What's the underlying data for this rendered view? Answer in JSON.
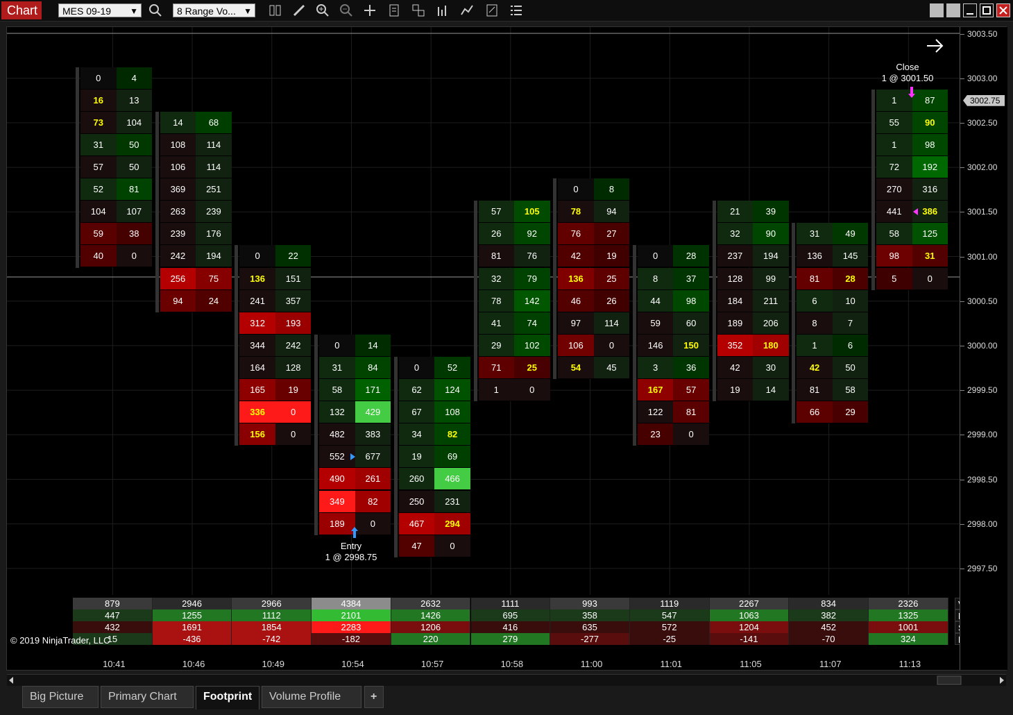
{
  "toolbar": {
    "title": "Chart",
    "instrument": "MES 09-19",
    "bar_type": "8 Range Vo...",
    "icons": [
      "search-icon",
      "bar-type-icon",
      "draw-icon",
      "zoom-in-icon",
      "zoom-out-icon",
      "crosshair-icon",
      "data-box-icon",
      "templates-icon",
      "indicators-icon",
      "strategies-icon",
      "properties-icon",
      "list-icon"
    ]
  },
  "colors": {
    "bid_strong": "#ff1a1a",
    "ask_strong": "#33cc33",
    "background": "#000000",
    "highlight_text": "#ffff00"
  },
  "price_axis": {
    "labels": [
      "3003.50",
      "3003.00",
      "3002.50",
      "3002.00",
      "3001.50",
      "3001.00",
      "3000.50",
      "3000.00",
      "2999.50",
      "2999.00",
      "2998.50",
      "2998.00",
      "2997.50"
    ],
    "current_price": "3002.75"
  },
  "bars": [
    {
      "time": "10:41",
      "top_price": 3003.0,
      "rows": [
        [
          "0",
          "4"
        ],
        [
          "16",
          "13"
        ],
        [
          "73",
          "104"
        ],
        [
          "31",
          "50"
        ],
        [
          "57",
          "50"
        ],
        [
          "52",
          "81"
        ],
        [
          "104",
          "107"
        ],
        [
          "59",
          "38"
        ],
        [
          "40",
          "0"
        ]
      ],
      "hl": [
        [
          1,
          0
        ],
        [
          2,
          0
        ]
      ]
    },
    {
      "time": "10:46",
      "top_price": 3002.5,
      "rows": [
        [
          "14",
          "68"
        ],
        [
          "108",
          "114"
        ],
        [
          "106",
          "114"
        ],
        [
          "369",
          "251"
        ],
        [
          "263",
          "239"
        ],
        [
          "239",
          "176"
        ],
        [
          "242",
          "194"
        ],
        [
          "256",
          "75"
        ],
        [
          "94",
          "24"
        ]
      ],
      "hl": []
    },
    {
      "time": "10:49",
      "top_price": 3001.0,
      "rows": [
        [
          "0",
          "22"
        ],
        [
          "136",
          "151"
        ],
        [
          "241",
          "357"
        ],
        [
          "312",
          "193"
        ],
        [
          "344",
          "242"
        ],
        [
          "164",
          "128"
        ],
        [
          "165",
          "19"
        ],
        [
          "336",
          "0"
        ],
        [
          "156",
          "0"
        ]
      ],
      "hl": [
        [
          1,
          0
        ],
        [
          7,
          0
        ],
        [
          8,
          0
        ]
      ]
    },
    {
      "time": "10:54",
      "top_price": 3000.0,
      "rows": [
        [
          "0",
          "14"
        ],
        [
          "31",
          "84"
        ],
        [
          "58",
          "171"
        ],
        [
          "132",
          "429"
        ],
        [
          "482",
          "383"
        ],
        [
          "552",
          "677"
        ],
        [
          "490",
          "261"
        ],
        [
          "349",
          "82"
        ],
        [
          "189",
          "0"
        ]
      ],
      "hl": []
    },
    {
      "time": "10:57",
      "top_price": 2999.75,
      "rows": [
        [
          "0",
          "52"
        ],
        [
          "62",
          "124"
        ],
        [
          "67",
          "108"
        ],
        [
          "34",
          "82"
        ],
        [
          "19",
          "69"
        ],
        [
          "260",
          "466"
        ],
        [
          "250",
          "231"
        ],
        [
          "467",
          "294"
        ],
        [
          "47",
          "0"
        ]
      ],
      "hl": [
        [
          3,
          1
        ],
        [
          7,
          1
        ]
      ]
    },
    {
      "time": "10:58",
      "top_price": 3001.5,
      "rows": [
        [
          "57",
          "105"
        ],
        [
          "26",
          "92"
        ],
        [
          "81",
          "76"
        ],
        [
          "32",
          "79"
        ],
        [
          "78",
          "142"
        ],
        [
          "41",
          "74"
        ],
        [
          "29",
          "102"
        ],
        [
          "71",
          "25"
        ],
        [
          "1",
          "0"
        ]
      ],
      "hl": [
        [
          0,
          1
        ],
        [
          7,
          1
        ]
      ]
    },
    {
      "time": "11:00",
      "top_price": 3001.75,
      "rows": [
        [
          "0",
          "8"
        ],
        [
          "78",
          "94"
        ],
        [
          "76",
          "27"
        ],
        [
          "42",
          "19"
        ],
        [
          "136",
          "25"
        ],
        [
          "46",
          "26"
        ],
        [
          "97",
          "114"
        ],
        [
          "106",
          "0"
        ],
        [
          "54",
          "45"
        ]
      ],
      "hl": [
        [
          1,
          0
        ],
        [
          4,
          0
        ],
        [
          8,
          0
        ]
      ]
    },
    {
      "time": "11:01",
      "top_price": 3001.0,
      "rows": [
        [
          "0",
          "28"
        ],
        [
          "8",
          "37"
        ],
        [
          "44",
          "98"
        ],
        [
          "59",
          "60"
        ],
        [
          "146",
          "150"
        ],
        [
          "3",
          "36"
        ],
        [
          "167",
          "57"
        ],
        [
          "122",
          "81"
        ],
        [
          "23",
          "0"
        ]
      ],
      "hl": [
        [
          4,
          1
        ],
        [
          6,
          0
        ]
      ]
    },
    {
      "time": "11:05",
      "top_price": 3001.5,
      "rows": [
        [
          "21",
          "39"
        ],
        [
          "32",
          "90"
        ],
        [
          "237",
          "194"
        ],
        [
          "128",
          "99"
        ],
        [
          "184",
          "211"
        ],
        [
          "189",
          "206"
        ],
        [
          "352",
          "180"
        ],
        [
          "42",
          "30"
        ],
        [
          "19",
          "14"
        ]
      ],
      "hl": [
        [
          6,
          1
        ]
      ]
    },
    {
      "time": "11:07",
      "top_price": 3001.25,
      "rows": [
        [
          "31",
          "49"
        ],
        [
          "136",
          "145"
        ],
        [
          "81",
          "28"
        ],
        [
          "6",
          "10"
        ],
        [
          "8",
          "7"
        ],
        [
          "1",
          "6"
        ],
        [
          "42",
          "50"
        ],
        [
          "81",
          "58"
        ],
        [
          "66",
          "29"
        ]
      ],
      "hl": [
        [
          2,
          1
        ],
        [
          6,
          0
        ]
      ]
    },
    {
      "time": "11:13",
      "top_price": 3002.75,
      "rows": [
        [
          "1",
          "87"
        ],
        [
          "55",
          "90"
        ],
        [
          "1",
          "98"
        ],
        [
          "72",
          "192"
        ],
        [
          "270",
          "316"
        ],
        [
          "441",
          "386"
        ],
        [
          "58",
          "125"
        ],
        [
          "98",
          "31"
        ],
        [
          "5",
          "0"
        ]
      ],
      "hl": [
        [
          1,
          1
        ],
        [
          5,
          1
        ],
        [
          7,
          1
        ]
      ]
    }
  ],
  "trades": {
    "entry": {
      "label": "Entry",
      "detail": "1 @ 2998.75"
    },
    "close": {
      "label": "Close",
      "detail": "1 @ 3001.50"
    }
  },
  "summary": {
    "labels": [
      "Volume",
      "Buy Vol",
      "Sell Vol",
      "Delta (Bar)"
    ],
    "volume": [
      "879",
      "2946",
      "2966",
      "4384",
      "2632",
      "1111",
      "993",
      "1119",
      "2267",
      "834",
      "2326"
    ],
    "buy_vol": [
      "447",
      "1255",
      "1112",
      "2101",
      "1426",
      "695",
      "358",
      "547",
      "1063",
      "382",
      "1325"
    ],
    "sell_vol": [
      "432",
      "1691",
      "1854",
      "2283",
      "1206",
      "416",
      "635",
      "572",
      "1204",
      "452",
      "1001"
    ],
    "delta": [
      "15",
      "-436",
      "-742",
      "-182",
      "220",
      "279",
      "-277",
      "-25",
      "-141",
      "-70",
      "324"
    ]
  },
  "copyright": "© 2019 NinjaTrader, LLC",
  "tabs": [
    "Big Picture",
    "Primary Chart",
    "Footprint",
    "Volume Profile"
  ],
  "active_tab": "Footprint",
  "add_tab_label": "+"
}
